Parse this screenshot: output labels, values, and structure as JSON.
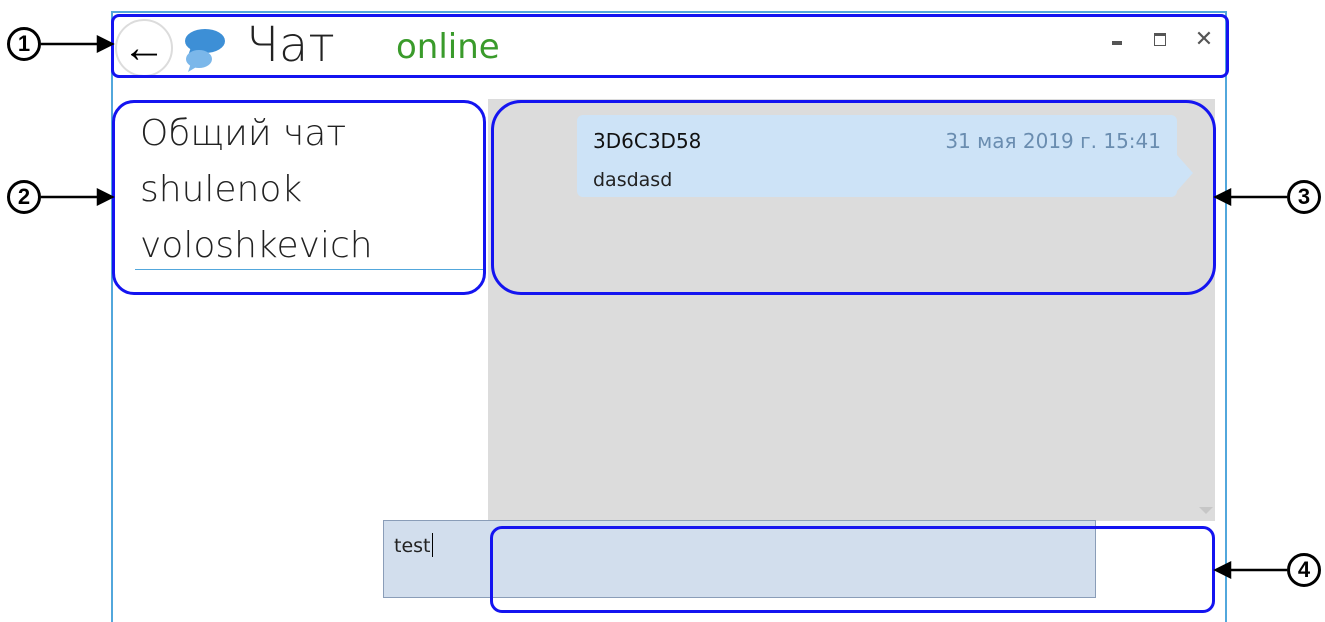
{
  "window": {
    "back_icon": "←",
    "title": "Чат",
    "status": "online",
    "minimize_icon": "▬",
    "close_icon": "✕"
  },
  "contacts": [
    {
      "label": "Общий чат"
    },
    {
      "label": "shulenok"
    },
    {
      "label": "voloshkevich"
    }
  ],
  "messages": [
    {
      "author": "3D6C3D58",
      "time": "31 мая 2019 г. 15:41",
      "text": "dasdasd"
    }
  ],
  "input": {
    "value": "test"
  },
  "callouts": [
    "1",
    "2",
    "3",
    "4"
  ],
  "colors": {
    "window_border": "#52a7dc",
    "status_online": "#3a9b2b",
    "bubble": "#cde3f7",
    "annotation": "#1414f0"
  }
}
